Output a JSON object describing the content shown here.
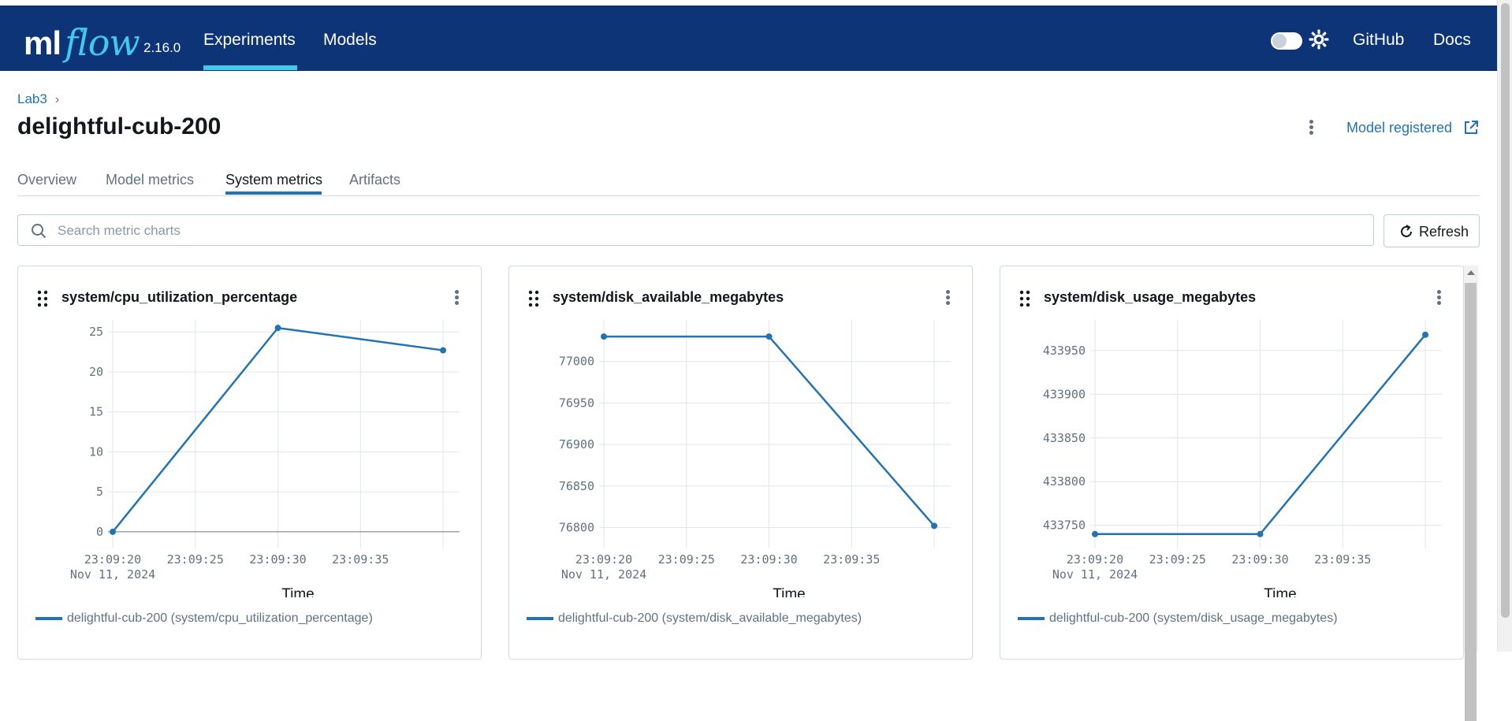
{
  "header": {
    "logo_ml": "ml",
    "logo_flow": "flow",
    "version": "2.16.0",
    "nav": [
      "Experiments",
      "Models"
    ],
    "active_nav": "Experiments",
    "github": "GitHub",
    "docs": "Docs"
  },
  "breadcrumb": {
    "experiment": "Lab3",
    "separator": "›"
  },
  "run": {
    "title": "delightful-cub-200"
  },
  "actions": {
    "model_registered": "Model registered"
  },
  "tabs": [
    "Overview",
    "Model metrics",
    "System metrics",
    "Artifacts"
  ],
  "active_tab": "System metrics",
  "search": {
    "placeholder": "Search metric charts",
    "value": ""
  },
  "refresh": {
    "label": "Refresh"
  },
  "colors": {
    "navbar": "#0e3478",
    "accent": "#43c9ed",
    "link": "#2272b4",
    "series": "#2272b4"
  },
  "charts": [
    {
      "title": "system/cpu_utilization_percentage",
      "legend": "delightful-cub-200 (system/cpu_utilization_percentage)"
    },
    {
      "title": "system/disk_available_megabytes",
      "legend": "delightful-cub-200 (system/disk_available_megabytes)"
    },
    {
      "title": "system/disk_usage_megabytes",
      "legend": "delightful-cub-200 (system/disk_usage_megabytes)"
    }
  ],
  "chart_data": [
    {
      "type": "line",
      "title": "system/cpu_utilization_percentage",
      "xlabel": "Time",
      "x_ticks": [
        "23:09:20",
        "23:09:25",
        "23:09:30",
        "23:09:35"
      ],
      "x_date_label": "Nov 11, 2024",
      "x": [
        "23:09:20",
        "23:09:30",
        "23:09:40"
      ],
      "xlim": [
        "23:09:20",
        "23:09:41"
      ],
      "yticks": [
        0,
        5,
        10,
        15,
        20,
        25
      ],
      "ylim": [
        -0.5,
        26.5
      ],
      "grid": true,
      "legend_position": "bottom",
      "series": [
        {
          "name": "delightful-cub-200 (system/cpu_utilization_percentage)",
          "values": [
            0,
            25.5,
            22.7
          ]
        }
      ]
    },
    {
      "type": "line",
      "title": "system/disk_available_megabytes",
      "xlabel": "Time",
      "x_ticks": [
        "23:09:20",
        "23:09:25",
        "23:09:30",
        "23:09:35"
      ],
      "x_date_label": "Nov 11, 2024",
      "x": [
        "23:09:20",
        "23:09:30",
        "23:09:40"
      ],
      "xlim": [
        "23:09:20",
        "23:09:41"
      ],
      "yticks": [
        76800,
        76850,
        76900,
        76950,
        77000
      ],
      "ylim": [
        76790,
        77050
      ],
      "grid": true,
      "legend_position": "bottom",
      "series": [
        {
          "name": "delightful-cub-200 (system/disk_available_megabytes)",
          "values": [
            77030,
            77030,
            76802
          ]
        }
      ]
    },
    {
      "type": "line",
      "title": "system/disk_usage_megabytes",
      "xlabel": "Time",
      "x_ticks": [
        "23:09:20",
        "23:09:25",
        "23:09:30",
        "23:09:35"
      ],
      "x_date_label": "Nov 11, 2024",
      "x": [
        "23:09:20",
        "23:09:30",
        "23:09:40"
      ],
      "xlim": [
        "23:09:20",
        "23:09:41"
      ],
      "yticks": [
        433750,
        433800,
        433850,
        433900,
        433950
      ],
      "ylim": [
        433738,
        433985
      ],
      "grid": true,
      "legend_position": "bottom",
      "series": [
        {
          "name": "delightful-cub-200 (system/disk_usage_megabytes)",
          "values": [
            433740,
            433740,
            433968
          ]
        }
      ]
    }
  ]
}
